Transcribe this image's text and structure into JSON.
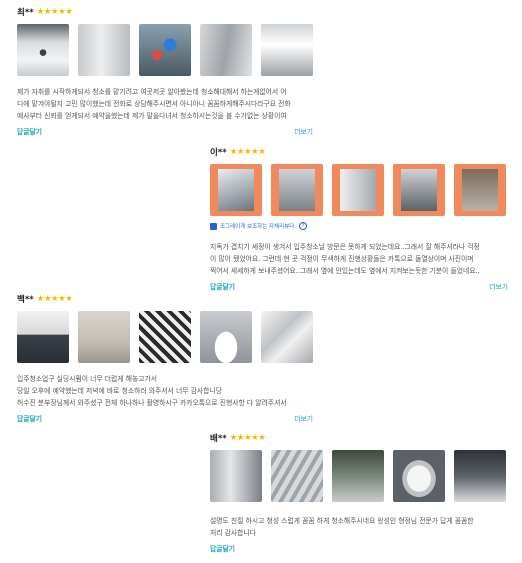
{
  "colors": {
    "star": "#f6b600",
    "link": "#1aa6b7",
    "badge": "#2b5fd9",
    "photo_frame": "#f08a5d"
  },
  "reviews": [
    {
      "author": "최**",
      "stars": "★★★★★",
      "text_lines": [
        "제가 자취를 시작하게되서 청소를 맡기려고 여곳저곳 알아봤는데 청소해대해서 하는게없어서 어",
        "디에 맡겨야될지 고민 많이했는데 전화로 상담해주시면서 아니아니 꼼꼼하게해주시다라구요 전화",
        "예사부터 신뢰를 얻게되서 예약을했는데 제가 말을다녀서 청소하시는것을 볼 수가없는 상황이여"
      ],
      "reply": "답글달기",
      "more": "더보기"
    },
    {
      "author": "이**",
      "stars": "★★★★★",
      "badge": "조그레이게 보조하는 자체리뷰다.",
      "text_lines": [
        "지독가 겹치기 세정이 생겨서 입주청소날 방문은 못하게 되었는데요..그래서 잘 해주셔라나 걱정",
        "이 많이 됐었어요. 그런데 현 곳 걱정이 무색하게 진행상황들은 카톡으로 둘열상이며 사진이며",
        "찍어서 세세하게 보내주셨어요..그래서 옆에 안있는데도 옆에서 지켜보는듯한 기분이 들었네요.."
      ],
      "reply": "답글달기",
      "more": "더보기"
    },
    {
      "author": "백**",
      "stars": "★★★★★",
      "text_lines": [
        "입주청소업구 실딩시펌이 너무 더럽게 해놓고가서",
        "당일 오후에 예약했는데 저녁에 바로 청소하러 와주셔서 너무 감사합니당",
        "허수진 분부장님께서 와주셨구 전체 하나하나 촬영하시구 카카오톡으로 진행사항 다 알려주셔서"
      ],
      "reply": "답글달기",
      "more": "더보기"
    },
    {
      "author": "배**",
      "stars": "★★★★★",
      "text_lines": [
        "설명도 친절 하시고 청성 스럽게 꼼꼼 하게 청소해주시네요 왕성인 형정님 전문가 답게 꼼꼼한",
        "처리 감사합니다"
      ],
      "reply": "답글달기"
    }
  ]
}
